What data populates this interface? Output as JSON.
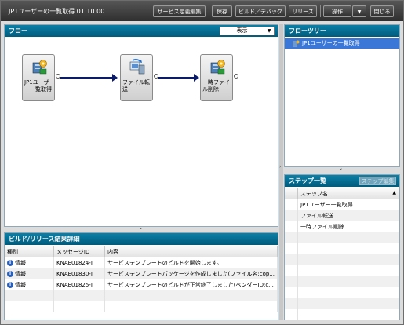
{
  "window": {
    "title": "JP1ユーザーの一覧取得 01.10.00",
    "buttons": {
      "service_def_edit": "サービス定義編集",
      "save": "保存",
      "build_debug": "ビルド／デバッグ",
      "release": "リリース",
      "operation": "操作",
      "operation_arrow": "▼",
      "close": "閉じる"
    }
  },
  "flow": {
    "title": "フロー",
    "view_combo": "表示",
    "combo_arrow": "▼",
    "nodes": [
      {
        "label": "JP1ユーザー一覧取得"
      },
      {
        "label": "ファイル転送"
      },
      {
        "label": "一時ファイル削除"
      }
    ]
  },
  "flow_tree": {
    "title": "フローツリー",
    "items": [
      {
        "label": "JP1ユーザーの一覧取得"
      }
    ]
  },
  "steps": {
    "title": "ステップ一覧",
    "edit_button": "ステップ編集",
    "column": "ステップ名",
    "sort_arrow": "▲",
    "rows": [
      "JP1ユーザー一覧取得",
      "ファイル転送",
      "一時ファイル削除"
    ]
  },
  "build_result": {
    "title": "ビルド/リリース結果詳細",
    "columns": [
      "種別",
      "メッセージID",
      "内容"
    ],
    "rows": [
      {
        "type": "情報",
        "message_id": "KNAE01824-I",
        "content": "サービステンプレートのビルドを開始します。"
      },
      {
        "type": "情報",
        "message_id": "KNAE01830-I",
        "content": "サービステンプレートパッケージを作成しました(ファイル名:cop..."
      },
      {
        "type": "情報",
        "message_id": "KNAE01825-I",
        "content": "サービステンプレートのビルドが正常終了しました(ベンダーID:c..."
      }
    ]
  },
  "grips": {
    "down": "⌄",
    "right": "›"
  }
}
